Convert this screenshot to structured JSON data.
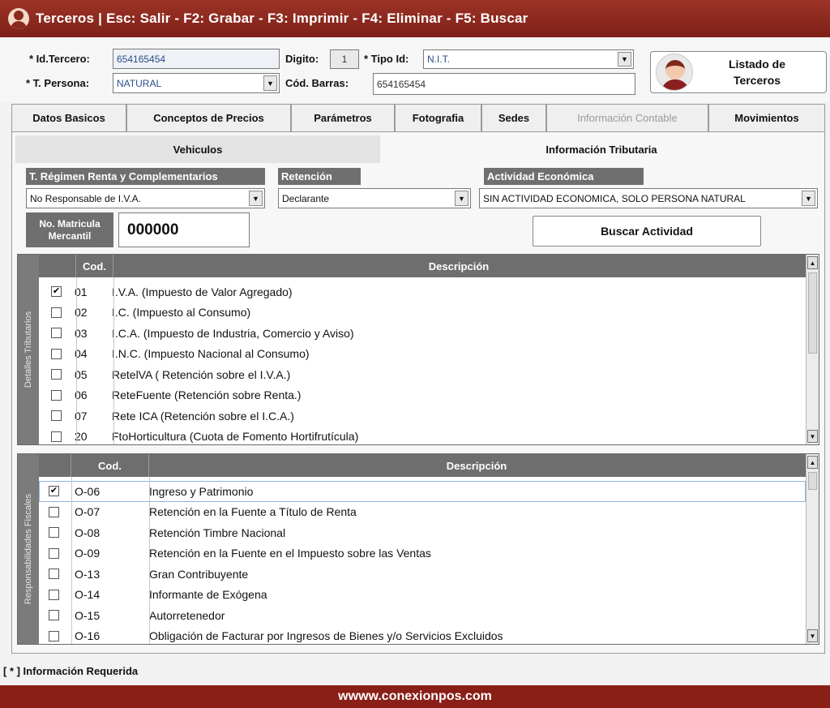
{
  "titlebar": {
    "text": "Terceros   |   Esc: Salir - F2: Grabar - F3: Imprimir - F4: Eliminar - F5: Buscar"
  },
  "form": {
    "id_tercero_label": "* Id.Tercero:",
    "id_tercero_value": "654165454",
    "digito_label": "Digito:",
    "digito_value": "1",
    "tipo_id_label": "* Tipo Id:",
    "tipo_id_value": "N.I.T.",
    "t_persona_label": "* T. Persona:",
    "t_persona_value": "NATURAL",
    "cod_barras_label": "Cód. Barras:",
    "cod_barras_value": "654165454"
  },
  "listado": {
    "label_line1": "Listado de",
    "label_line2": "Terceros"
  },
  "tabs": [
    {
      "label": "Datos Basicos"
    },
    {
      "label": "Conceptos de Precios"
    },
    {
      "label": "Parámetros"
    },
    {
      "label": "Fotografia"
    },
    {
      "label": "Sedes"
    },
    {
      "label": "Información Contable"
    },
    {
      "label": "Movimientos"
    }
  ],
  "subtabs": {
    "vehiculos": "Vehiculos",
    "info_tributaria": "Información Tributaria"
  },
  "tributaria": {
    "regimen_label": "T. Régimen Renta y Complementarios",
    "regimen_value": "No Responsable de I.V.A.",
    "retencion_label": "Retención",
    "retencion_value": "Declarante",
    "actividad_label": "Actividad Económica",
    "actividad_value": "SIN ACTIVIDAD ECONOMICA, SOLO PERSONA NATURAL",
    "matricula_label_1": "No. Matricula",
    "matricula_label_2": "Mercantil",
    "matricula_value": "000000",
    "buscar_actividad": "Buscar Actividad"
  },
  "detalles": {
    "side_label": "Detalles Tributarios",
    "col_cod": "Cod.",
    "col_desc": "Descripción",
    "rows": [
      {
        "checked": "✔",
        "cod": "01",
        "desc": "I.V.A. (Impuesto de Valor Agregado)"
      },
      {
        "checked": "",
        "cod": "02",
        "desc": "I.C. (Impuesto al Consumo)"
      },
      {
        "checked": "",
        "cod": "03",
        "desc": "I.C.A. (Impuesto de Industria, Comercio y Aviso)"
      },
      {
        "checked": "",
        "cod": "04",
        "desc": "I.N.C. (Impuesto Nacional al Consumo)"
      },
      {
        "checked": "",
        "cod": "05",
        "desc": "RetelVA ( Retención sobre el I.V.A.)"
      },
      {
        "checked": "",
        "cod": "06",
        "desc": "ReteFuente (Retención sobre Renta.)"
      },
      {
        "checked": "",
        "cod": "07",
        "desc": "Rete ICA (Retención sobre el I.C.A.)"
      },
      {
        "checked": "",
        "cod": "20",
        "desc": "FtoHorticultura (Cuota de Fomento  Hortifrutícula)"
      }
    ]
  },
  "responsabilidades": {
    "side_label": "Responsabilidades Fiscales",
    "col_cod": "Cod.",
    "col_desc": "Descripción",
    "rows": [
      {
        "checked": "✔",
        "cod": "O-06",
        "desc": "Ingreso y Patrimonio"
      },
      {
        "checked": "",
        "cod": "O-07",
        "desc": "Retención en la Fuente a Título de Renta"
      },
      {
        "checked": "",
        "cod": "O-08",
        "desc": "Retención Timbre Nacional"
      },
      {
        "checked": "",
        "cod": "O-09",
        "desc": "Retención en la Fuente en el Impuesto sobre las Ventas"
      },
      {
        "checked": "",
        "cod": "O-13",
        "desc": "Gran Contribuyente"
      },
      {
        "checked": "",
        "cod": "O-14",
        "desc": "Informante de Exógena"
      },
      {
        "checked": "",
        "cod": "O-15",
        "desc": "Autorretenedor"
      },
      {
        "checked": "",
        "cod": "O-16",
        "desc": "Obligación de Facturar por Ingresos de Bienes y/o Servicios Excluidos"
      }
    ]
  },
  "footer": {
    "note": "[ * ] Información Requerida",
    "url": "wwww.conexionpos.com"
  },
  "colors": {
    "brand": "#8a1f18",
    "header_gray": "#6e6e6e"
  }
}
